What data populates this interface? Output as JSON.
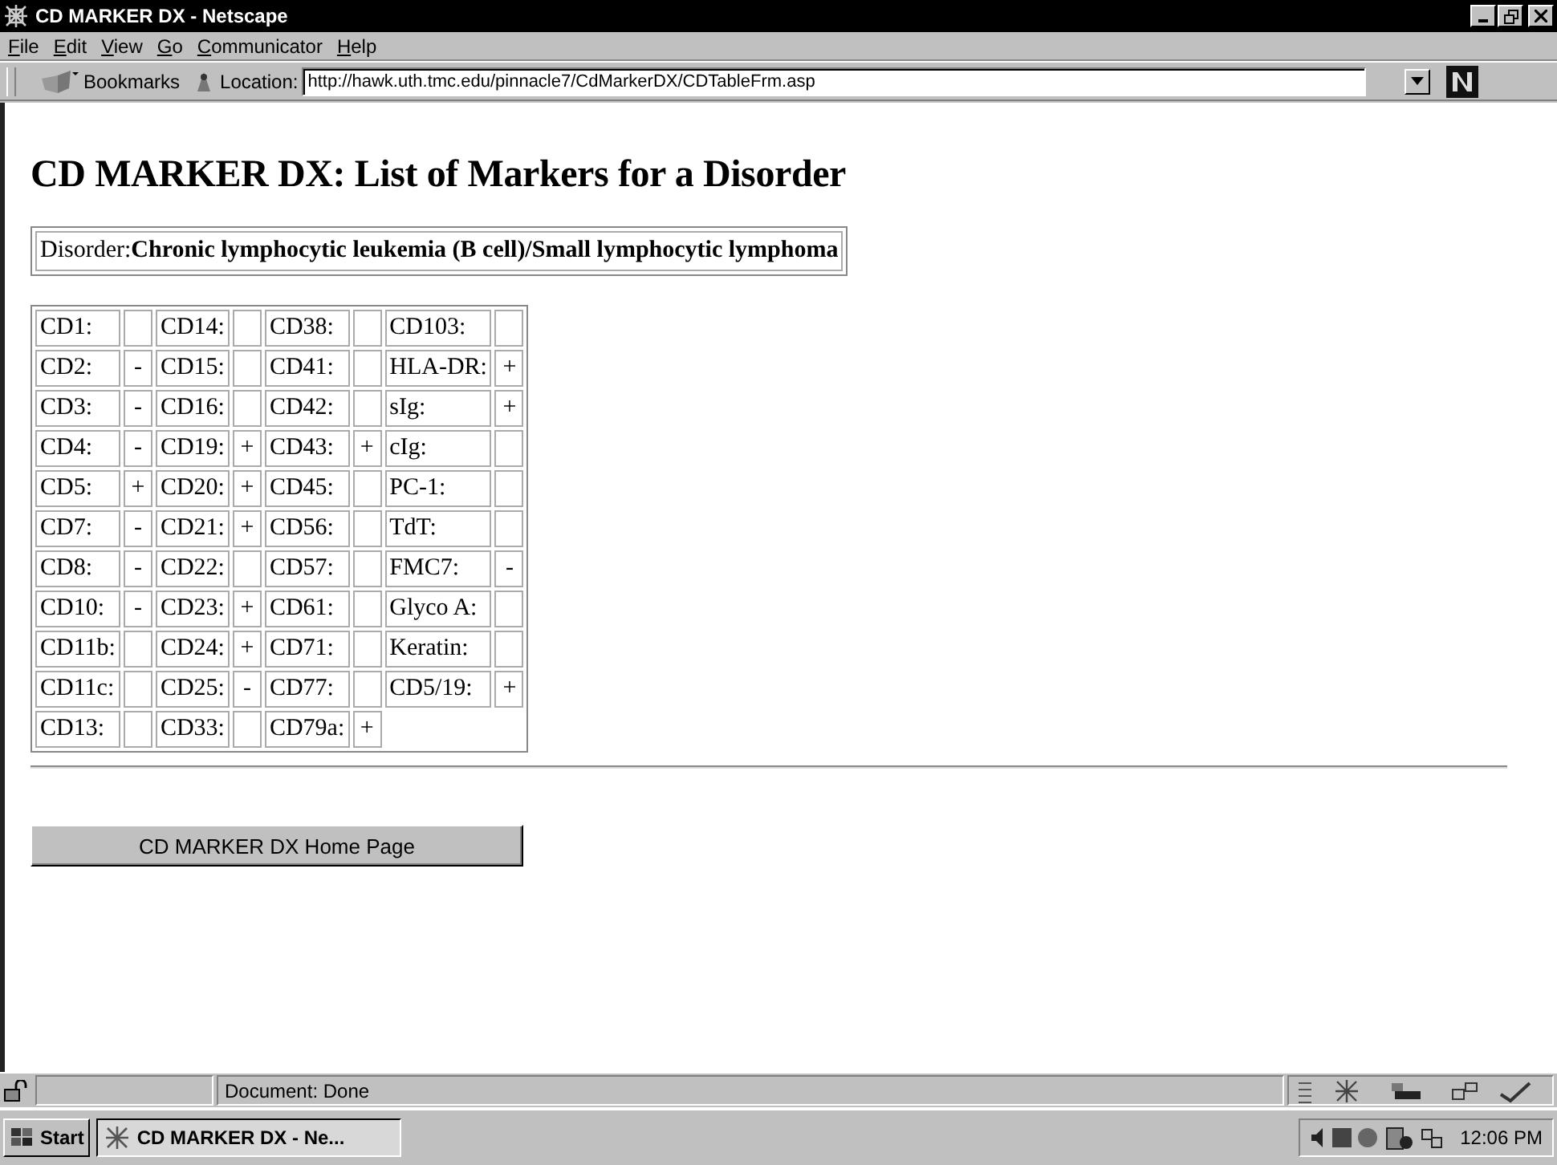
{
  "window": {
    "title": "CD MARKER DX - Netscape"
  },
  "menu": [
    "File",
    "Edit",
    "View",
    "Go",
    "Communicator",
    "Help"
  ],
  "toolbar": {
    "bookmarks": "Bookmarks",
    "location_label": "Location:",
    "url": "http://hawk.uth.tmc.edu/pinnacle7/CdMarkerDX/CDTableFrm.asp"
  },
  "page": {
    "heading": "CD MARKER DX: List of Markers for a Disorder",
    "disorder_label": "Disorder:",
    "disorder": "Chronic lymphocytic leukemia (B cell)/Small lymphocytic lymphoma",
    "rows": [
      [
        {
          "marker": "CD1:"
        },
        {
          "marker": "CD14:"
        },
        {
          "marker": "CD38:"
        },
        {
          "marker": "CD103:"
        }
      ],
      [
        {
          "marker": "CD2:",
          "result": "-"
        },
        {
          "marker": "CD15:"
        },
        {
          "marker": "CD41:"
        },
        {
          "marker": "HLA-DR:",
          "result": "+"
        }
      ],
      [
        {
          "marker": "CD3:",
          "result": "-"
        },
        {
          "marker": "CD16:"
        },
        {
          "marker": "CD42:"
        },
        {
          "marker": "sIg:",
          "result": "+"
        }
      ],
      [
        {
          "marker": "CD4:",
          "result": "-"
        },
        {
          "marker": "CD19:",
          "result": "+"
        },
        {
          "marker": "CD43:",
          "result": "+"
        },
        {
          "marker": "cIg:"
        }
      ],
      [
        {
          "marker": "CD5:",
          "result": "+"
        },
        {
          "marker": "CD20:",
          "result": "+"
        },
        {
          "marker": "CD45:"
        },
        {
          "marker": "PC-1:"
        }
      ],
      [
        {
          "marker": "CD7:",
          "result": "-"
        },
        {
          "marker": "CD21:",
          "result": "+"
        },
        {
          "marker": "CD56:"
        },
        {
          "marker": "TdT:"
        }
      ],
      [
        {
          "marker": "CD8:",
          "result": "-"
        },
        {
          "marker": "CD22:"
        },
        {
          "marker": "CD57:"
        },
        {
          "marker": "FMC7:",
          "result": "-"
        }
      ],
      [
        {
          "marker": "CD10:",
          "result": "-"
        },
        {
          "marker": "CD23:",
          "result": "+"
        },
        {
          "marker": "CD61:"
        },
        {
          "marker": "Glyco A:"
        }
      ],
      [
        {
          "marker": "CD11b:"
        },
        {
          "marker": "CD24:",
          "result": "+"
        },
        {
          "marker": "CD71:"
        },
        {
          "marker": "Keratin:"
        }
      ],
      [
        {
          "marker": "CD11c:"
        },
        {
          "marker": "CD25:",
          "result": "-"
        },
        {
          "marker": "CD77:"
        },
        {
          "marker": "CD5/19:",
          "result": "+"
        }
      ],
      [
        {
          "marker": "CD13:"
        },
        {
          "marker": "CD33:"
        },
        {
          "marker": "CD79a:",
          "result": "+"
        }
      ]
    ],
    "home_button": "CD MARKER DX Home Page"
  },
  "status_bar": {
    "text": "Document: Done"
  },
  "taskbar": {
    "start": "Start",
    "task": "CD MARKER DX - Ne...",
    "clock": "12:06 PM"
  }
}
